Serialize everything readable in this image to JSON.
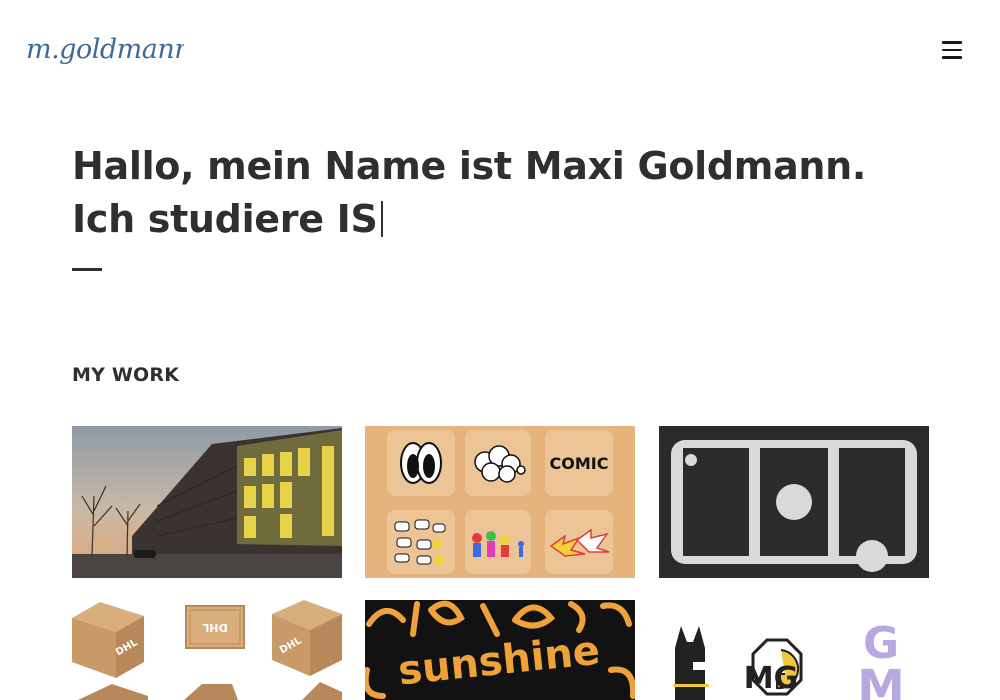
{
  "header": {
    "logo_text": "m.goldmann",
    "menu_icon": "hamburger-menu-icon"
  },
  "hero": {
    "line1": "Hallo, mein Name ist Maxi Goldmann.",
    "line2": "Ich studiere IS"
  },
  "work": {
    "title": "MY WORK",
    "items": [
      {
        "name": "architecture-photo"
      },
      {
        "name": "comic-stickers",
        "word": "COMIC"
      },
      {
        "name": "film-strip-graphic"
      },
      {
        "name": "dhl-package-illustrations",
        "box_label": "DHL"
      },
      {
        "name": "sunshine-typography",
        "word": "sunshine"
      },
      {
        "name": "monogram-logos",
        "monogram": "MG",
        "letters": [
          "G",
          "M"
        ]
      }
    ]
  },
  "colors": {
    "text": "#2f2f2f",
    "logo_blue": "#3d6a9c",
    "comic_bg": "#e6b37c",
    "film_dark": "#2b2b2b",
    "cardboard": "#c79a68",
    "sunshine_orange": "#f0a23a",
    "monogram_purple": "#b8a8e0",
    "monogram_yellow": "#f2c73a"
  }
}
